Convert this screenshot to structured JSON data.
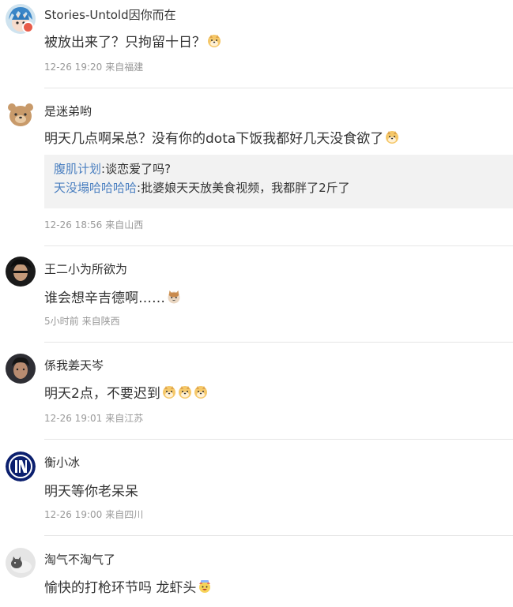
{
  "comments": [
    {
      "username": "Stories-Untold因你而在",
      "text": "被放出来了？只拘留十日？",
      "emoji": [
        "doge-emoji"
      ],
      "time": "12-26 19:20",
      "location": "来自福建"
    },
    {
      "username": "是迷弟哟",
      "text": "明天几点啊呆总？没有你的dota下饭我都好几天没食欲了",
      "emoji": [
        "doge-emoji"
      ],
      "replies": [
        {
          "name": "腹肌计划",
          "text": ":谈恋爱了吗?"
        },
        {
          "name": "天没塌哈哈哈哈",
          "text": ":批婆娘天天放美食视频，我都胖了2斤了"
        }
      ],
      "time": "12-26 18:56",
      "location": "来自山西"
    },
    {
      "username": "王二小为所欲为",
      "text": "谁会想辛吉德啊……",
      "emoji": [
        "cat-emoji"
      ],
      "time": "5小时前",
      "location": "来自陕西"
    },
    {
      "username": "係我姜天岑",
      "text": "明天2点，不要迟到",
      "emoji": [
        "doge-emoji",
        "doge-emoji",
        "doge-emoji"
      ],
      "time": "12-26 19:01",
      "location": "来自江苏"
    },
    {
      "username": "衡小冰",
      "text": "明天等你老呆呆",
      "emoji": [],
      "time": "12-26 19:00",
      "location": "来自四川"
    },
    {
      "username": "淘气不淘气了",
      "text": "愉快的打枪环节吗 龙虾头",
      "emoji": [
        "cheer-emoji"
      ],
      "time": "",
      "location": ""
    }
  ],
  "colors": {
    "username": "#333333",
    "meta": "#999999",
    "reply_name": "#4a7fc0",
    "reply_bg": "#f2f2f2",
    "divider": "#e6e6e6"
  }
}
